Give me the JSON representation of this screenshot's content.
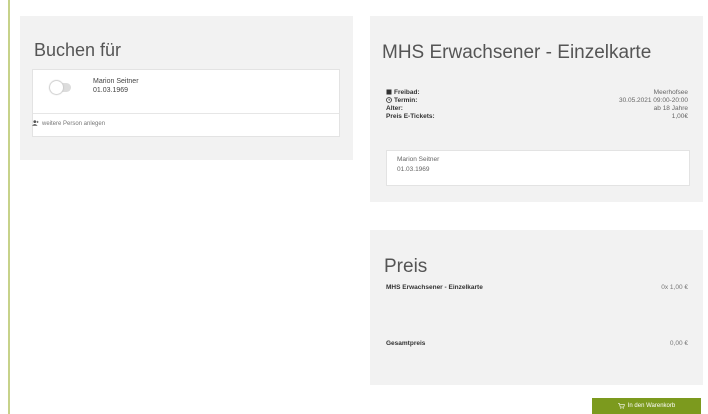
{
  "booking": {
    "title": "Buchen für",
    "person": {
      "name": "Marion Seitner",
      "birthdate": "01.03.1969"
    },
    "add_person_label": "weitere Person anlegen"
  },
  "ticket": {
    "title": "MHS Erwachsener - Einzelkarte",
    "details": [
      {
        "icon": "building-icon",
        "label": "Freibad:",
        "value": "Meerhofsee"
      },
      {
        "icon": "clock-icon",
        "label": "Termin:",
        "value": "30.05.2021 09:00-20:00"
      },
      {
        "icon": "",
        "label": "Alter:",
        "value": "ab 18 Jahre"
      },
      {
        "icon": "",
        "label": "Preis E-Tickets:",
        "value": "1,00€"
      }
    ],
    "assigned_person": {
      "name": "Marion Seitner",
      "birthdate": "01.03.1969"
    }
  },
  "price": {
    "title": "Preis",
    "item_label": "MHS Erwachsener - Einzelkarte",
    "item_value": "0x 1,00 €",
    "total_label": "Gesamtpreis",
    "total_value": "0,00 €"
  },
  "actions": {
    "cart_button_label": "In den Warenkorb"
  },
  "colors": {
    "accent": "#7c9a1e",
    "card_bg": "#f2f2f2"
  }
}
